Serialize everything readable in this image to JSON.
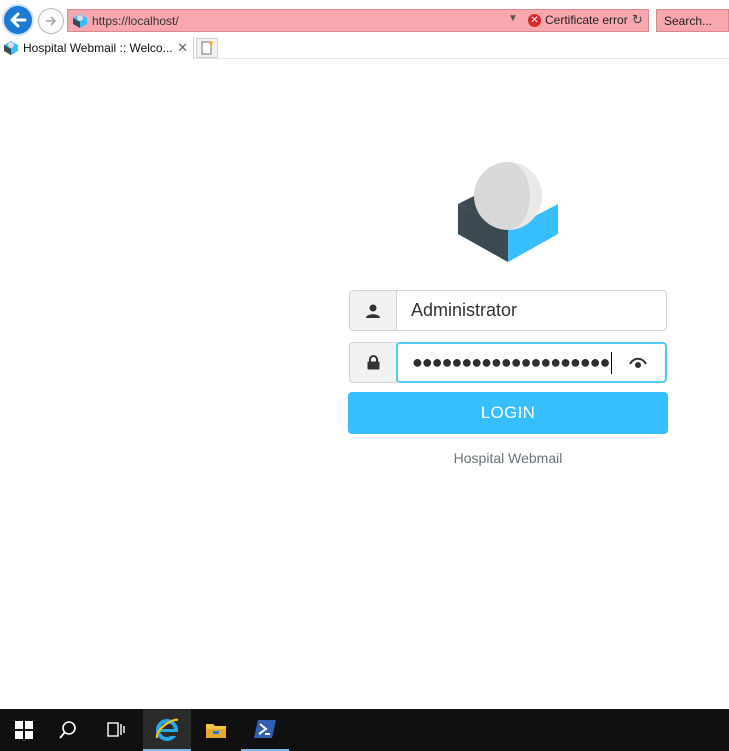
{
  "browser": {
    "url": "https://localhost/",
    "certificate_error": "Certificate error",
    "search_placeholder": "Search...",
    "tab_title": "Hospital Webmail :: Welco..."
  },
  "login": {
    "username_value": "Administrator",
    "password_masked": "●●●●●●●●●●●●●●●●●●●●",
    "login_button": "LOGIN",
    "footer": "Hospital Webmail"
  },
  "colors": {
    "accent": "#37beff",
    "address_bar_error": "#f7a7ad",
    "taskbar": "#101010"
  },
  "icons": [
    "back-arrow-icon",
    "forward-arrow-icon",
    "site-icon",
    "certificate-error-icon",
    "refresh-icon",
    "close-icon",
    "new-tab-icon",
    "user-icon",
    "lock-icon",
    "eye-icon",
    "windows-start-icon",
    "search-icon",
    "task-view-icon",
    "internet-explorer-icon",
    "file-explorer-icon",
    "powershell-icon"
  ]
}
